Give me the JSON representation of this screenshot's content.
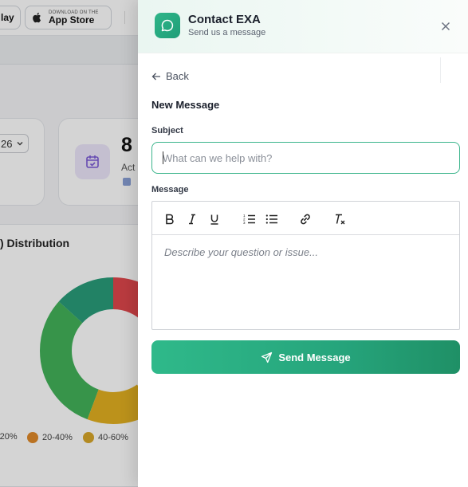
{
  "background": {
    "store_badges": {
      "google_play_label": "lay",
      "app_store_small": "DOWNLOAD ON THE",
      "app_store_big": "App Store"
    },
    "filter_select_value": "26",
    "stat_card": {
      "value": "8",
      "label": "Act"
    },
    "chart": {
      "title": ") Distribution",
      "legend": [
        {
          "label": "-20%",
          "color": "#e07a5f"
        },
        {
          "label": "20-40%",
          "color": "#e08a2a"
        },
        {
          "label": "40-60%",
          "color": "#d8a62a"
        }
      ]
    }
  },
  "chart_data": {
    "type": "pie",
    "title": ") Distribution",
    "categories": [
      "-20%",
      "20-40%",
      "40-60%"
    ],
    "legend_placement": "bottom"
  },
  "drawer": {
    "title": "Contact EXA",
    "subtitle": "Send us a message",
    "back_label": "Back",
    "section_title": "New Message",
    "subject_label": "Subject",
    "subject_placeholder": "What can we help with?",
    "subject_value": "",
    "message_label": "Message",
    "message_placeholder": "Describe your question or issue...",
    "send_label": "Send Message",
    "toolbar": [
      "bold-icon",
      "italic-icon",
      "underline-icon",
      "ordered-list-icon",
      "bullet-list-icon",
      "link-icon",
      "clear-format-icon"
    ]
  }
}
